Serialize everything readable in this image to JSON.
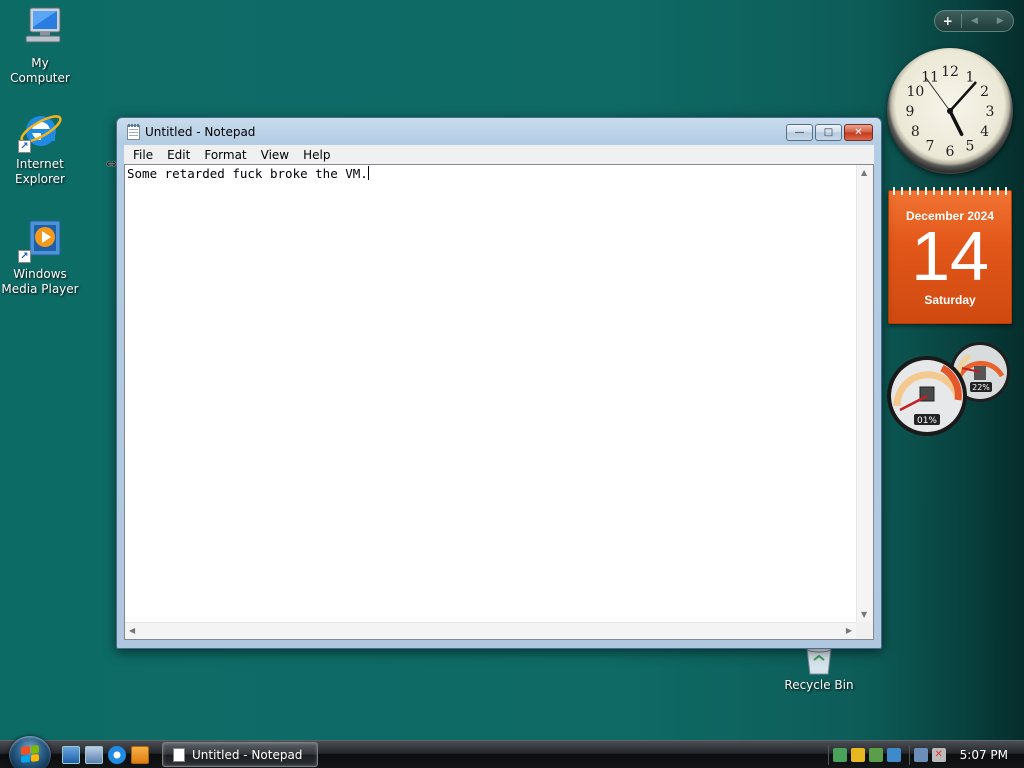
{
  "desktop": {
    "icons": [
      {
        "label": "My Computer",
        "icon": "computer-icon"
      },
      {
        "label": "Internet Explorer",
        "icon": "internet-explorer-icon"
      },
      {
        "label": "Windows Media Player",
        "icon": "media-player-icon"
      },
      {
        "label": "Recycle Bin",
        "icon": "recycle-bin-icon"
      }
    ]
  },
  "sidebar": {
    "add_gadget": "+",
    "prev": "◀",
    "next": "▶",
    "clock": {
      "numbers": [
        "12",
        "1",
        "2",
        "3",
        "4",
        "5",
        "6",
        "7",
        "8",
        "9",
        "10",
        "11"
      ],
      "hour": 5,
      "minute": 7,
      "second": 54
    },
    "calendar": {
      "month_year": "December 2024",
      "day": "14",
      "weekday": "Saturday"
    },
    "cpu_meter": {
      "cpu": "01%",
      "memory": "22%"
    }
  },
  "notepad": {
    "title": "Untitled - Notepad",
    "menu": [
      "File",
      "Edit",
      "Format",
      "View",
      "Help"
    ],
    "content": "Some retarded fuck broke the VM.",
    "buttons": {
      "minimize": "—",
      "maximize": "□",
      "close": "✕"
    }
  },
  "taskbar": {
    "task_label": "Untitled - Notepad",
    "time": "5:07 PM"
  },
  "colors": {
    "desktop": "#0e6763",
    "calendar": "#e3571a",
    "taskbar": "#1b1d20"
  }
}
